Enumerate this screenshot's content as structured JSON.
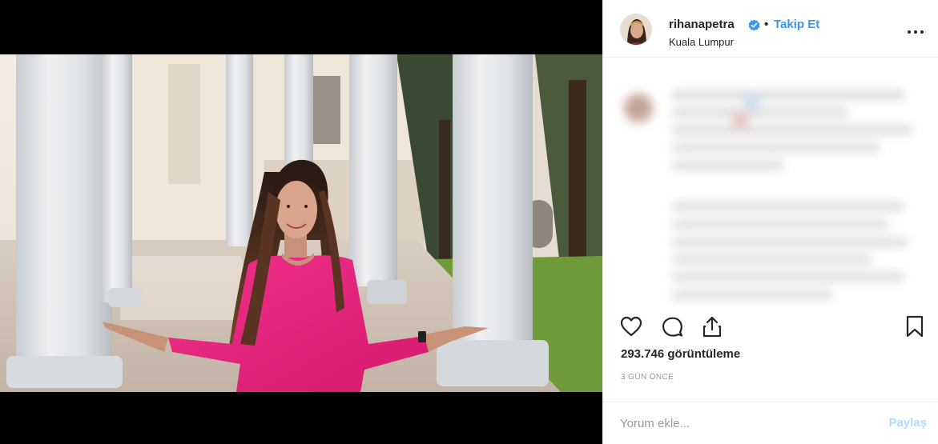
{
  "post": {
    "username": "rihanapetra",
    "separator": "•",
    "follow_label": "Takip Et",
    "location": "Kuala Lumpur",
    "views": "293.746 görüntüleme",
    "timestamp": "3 GÜN ÖNCE"
  },
  "comment_box": {
    "placeholder": "Yorum ekle...",
    "share_label": "Paylaş"
  },
  "icons": {
    "verified": "verified-badge-icon",
    "more": "more-options-icon",
    "like": "heart-icon",
    "comment": "comment-icon",
    "share": "share-icon",
    "save": "bookmark-icon"
  },
  "colors": {
    "link_blue": "#3897f0",
    "share_disabled": "#b3dbff",
    "dress_pink": "#e8237b"
  }
}
